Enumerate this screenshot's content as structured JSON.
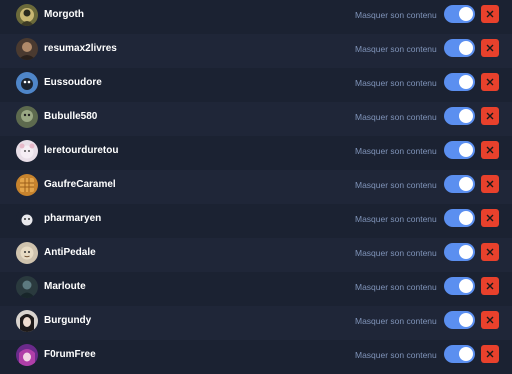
{
  "accounts": [
    {
      "name": "Morgoth",
      "toggle": true
    },
    {
      "name": "resumax2livres",
      "toggle": true
    },
    {
      "name": "Eussoudore",
      "toggle": true
    },
    {
      "name": "Bubulle580",
      "toggle": true
    },
    {
      "name": "leretourduretou",
      "toggle": true
    },
    {
      "name": "GaufreCaramel",
      "toggle": true
    },
    {
      "name": "pharmaryen",
      "toggle": true
    },
    {
      "name": "AntiPedale",
      "toggle": true
    },
    {
      "name": "Marloute",
      "toggle": true
    },
    {
      "name": "Burgundy",
      "toggle": true
    },
    {
      "name": "F0rumFree",
      "toggle": true
    }
  ],
  "labels": {
    "mask": "Masquer son contenu"
  },
  "colors": {
    "background": "#1b2232",
    "toggle_on": "#5b8ff0",
    "remove_button": "#e8412c",
    "mask_text": "#7f93b8"
  },
  "icons": {
    "remove": "close-icon",
    "avatar": "user-avatar"
  }
}
